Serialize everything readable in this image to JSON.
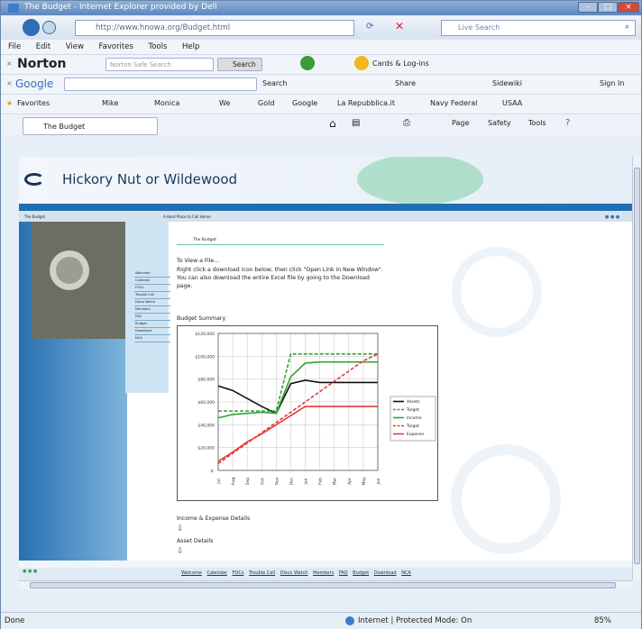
{
  "window": {
    "title": "The Budget - Internet Explorer provided by Dell"
  },
  "address": {
    "url": "http://www.hnowa.org/Budget.html",
    "search_placeholder": "Live Search"
  },
  "menu": [
    "File",
    "Edit",
    "View",
    "Favorites",
    "Tools",
    "Help"
  ],
  "norton": {
    "label": "Norton",
    "search_placeholder": "Norton Safe Search",
    "search_btn": "Search",
    "cards": "Cards & Log-ins"
  },
  "google": {
    "label": "Google",
    "search": "Search",
    "share": "Share",
    "sidewiki": "Sidewiki",
    "signin": "Sign In"
  },
  "favorites": {
    "label": "Favorites",
    "items": [
      "Mike",
      "Monica",
      "We",
      "Gold",
      "Google",
      "La Repubblica.it",
      "Navy Federal",
      "USAA"
    ]
  },
  "tab": {
    "title": "The Budget",
    "page": "Page",
    "safety": "Safety",
    "tools": "Tools"
  },
  "site": {
    "header": "Hickory Nut or Wildewood",
    "crumb_left": "The Budget",
    "crumb_mid": "A Hard Place to Call Home",
    "dots": "● ● ●"
  },
  "sidenav": [
    "Welcome",
    "Calendar",
    "FOCs",
    "Trouble Call",
    "Disco Watch",
    "Members",
    "FAQ",
    "Budget",
    "Download",
    "NCA"
  ],
  "page": {
    "section": "The Budget",
    "view_title": "To View a File...",
    "instructions": [
      "Right click a download icon below, then click \"Open Link in New Window\".",
      "You can also download the entire Excel file by going to the Download",
      "page."
    ],
    "summary_title": "Budget Summary",
    "income_link": "Income & Expense Details",
    "asset_link": "Asset Details"
  },
  "footer": {
    "dots": "● ● ●",
    "links": [
      "Welcome",
      "Calendar",
      "FOCs",
      "Trouble Call",
      "Disco Watch",
      "Members",
      "FAQ",
      "Budget",
      "Download",
      "NCA"
    ]
  },
  "status": {
    "left": "Done",
    "zone": "Internet | Protected Mode: On",
    "zoom": "85%"
  },
  "chart_data": {
    "type": "line",
    "x": [
      "Jul",
      "Aug",
      "Sep",
      "Oct",
      "Nov",
      "Dec",
      "Jan",
      "Feb",
      "Mar",
      "Apr",
      "May",
      "Jun"
    ],
    "y_ticks": [
      "$120,000",
      "$100,000",
      "$80,000",
      "$60,000",
      "$40,000",
      "$20,000",
      "$-"
    ],
    "ylim": [
      0,
      120000
    ],
    "series": [
      {
        "name": "Assets",
        "color": "#111111",
        "dash": false,
        "values": [
          74000,
          70000,
          63000,
          56000,
          50000,
          76000,
          79000,
          77000,
          77000,
          77000,
          77000,
          77000
        ]
      },
      {
        "name": "Target",
        "color": "#33a333",
        "dash": true,
        "values": [
          52000,
          52000,
          52000,
          52000,
          52000,
          102000,
          102000,
          102000,
          102000,
          102000,
          102000,
          102000
        ]
      },
      {
        "name": "Income",
        "color": "#33a333",
        "dash": false,
        "values": [
          46000,
          49000,
          50000,
          51000,
          50000,
          82000,
          94000,
          95000,
          95000,
          95000,
          95000,
          95000
        ]
      },
      {
        "name": "Target",
        "color": "#e43a3a",
        "dash": true,
        "values": [
          6000,
          15000,
          24000,
          33000,
          42000,
          51000,
          60000,
          69000,
          78000,
          87000,
          96000,
          102000
        ]
      },
      {
        "name": "Expense",
        "color": "#e43a3a",
        "dash": false,
        "values": [
          8000,
          16000,
          25000,
          32000,
          40000,
          48000,
          56000,
          56000,
          56000,
          56000,
          56000,
          56000
        ]
      }
    ]
  }
}
